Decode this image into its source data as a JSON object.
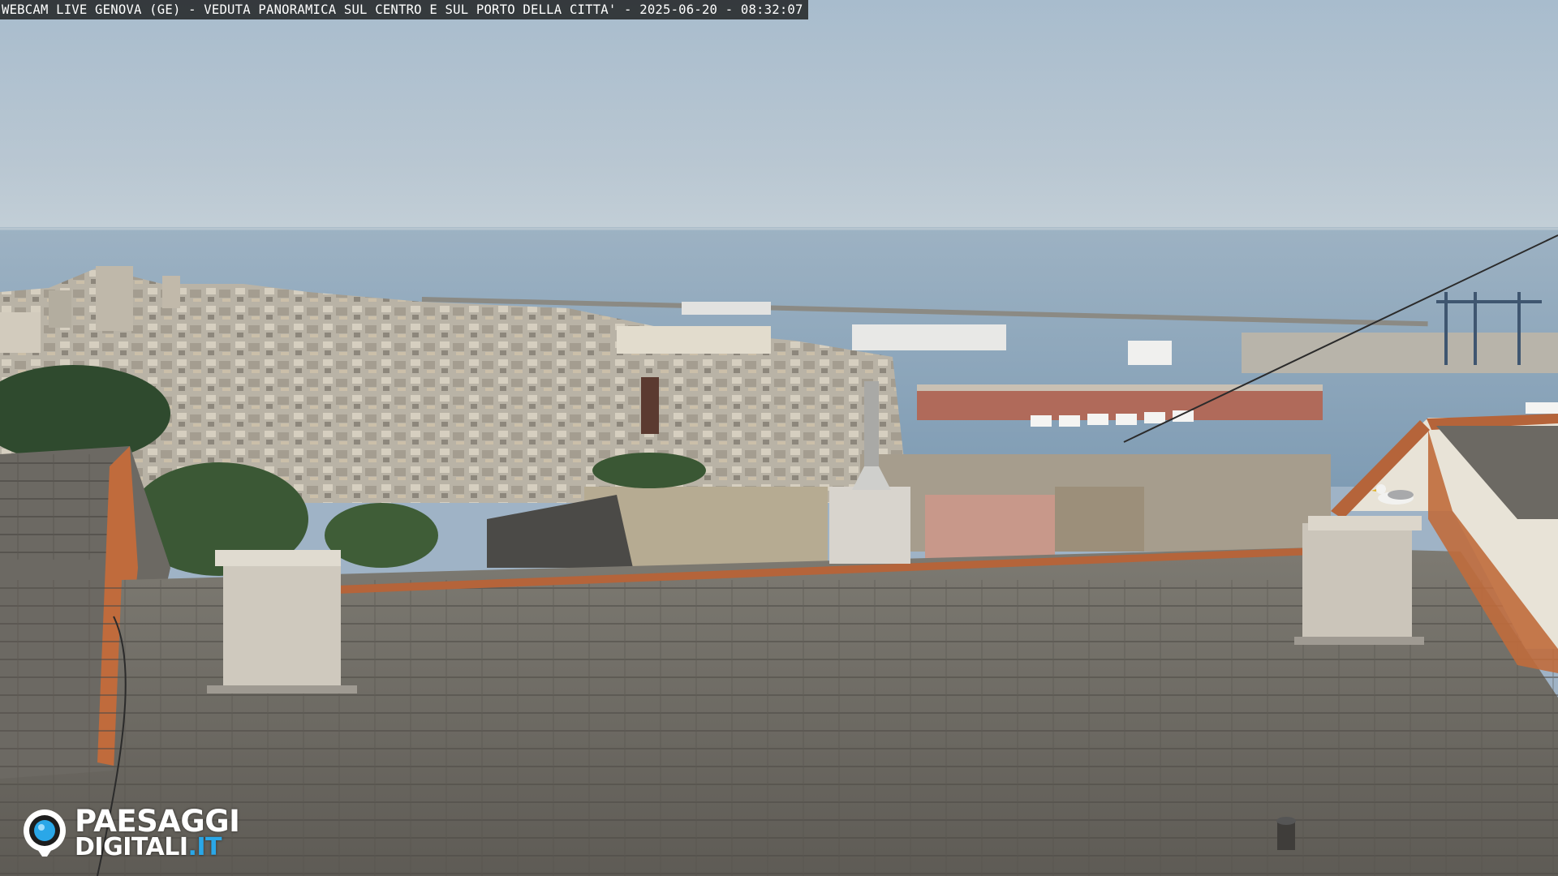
{
  "overlay": {
    "title": "WEBCAM LIVE GENOVA (GE) - VEDUTA PANORAMICA SUL CENTRO E SUL PORTO DELLA CITTA' - 2025-06-20 - 08:32:07"
  },
  "logo": {
    "line1": "PAESAGGI",
    "line2_main": "DIGITALI",
    "line2_suffix": ".IT",
    "icon": "webcam-lens-icon"
  },
  "scene": {
    "description_icons": [
      "rooftop",
      "chimney",
      "seagull",
      "harbor",
      "cranes",
      "ships"
    ],
    "colors": {
      "sky_top": "#a9bccd",
      "sky_horizon": "#c5d1d9",
      "sea": "#8faac0",
      "roof": "#6f6b63",
      "tile_edge": "#b5643a",
      "brand_blue": "#2aa7e8"
    }
  }
}
